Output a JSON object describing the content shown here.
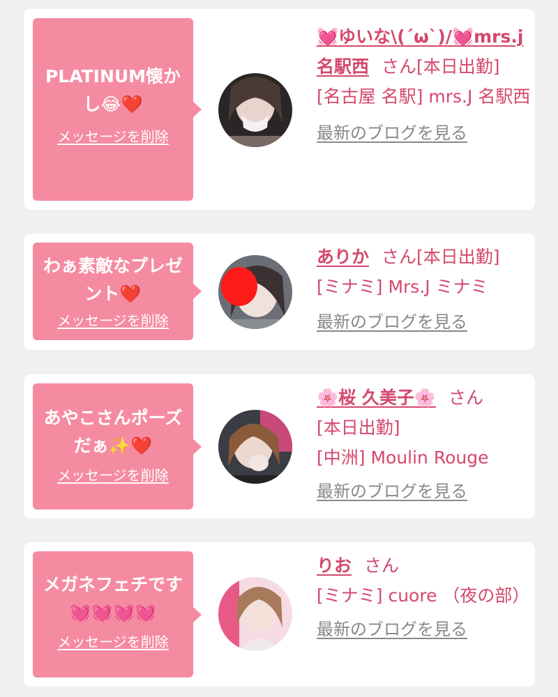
{
  "messages": [
    {
      "message": "PLATINUM懐かし😂❤️",
      "delete_label": "メッセージを削除",
      "name": "💓ゆいな\\(´ω`)/💓mrs.j名駅西",
      "honorific": "さん",
      "status": "[本日出勤]",
      "shop": "[名古屋 名駅] mrs.J 名駅西",
      "blog_link": "最新のブログを見る"
    },
    {
      "message": "わぁ素敵なプレゼント❤️",
      "delete_label": "メッセージを削除",
      "name": "ありか",
      "honorific": "さん",
      "status": "[本日出勤]",
      "shop": "[ミナミ] Mrs.J ミナミ",
      "blog_link": "最新のブログを見る"
    },
    {
      "message": "あやこさんポーズだぁ✨❤️",
      "delete_label": "メッセージを削除",
      "name": "🌸桜 久美子🌸",
      "honorific": "さん",
      "status": "[本日出勤]",
      "shop": "[中洲] Moulin Rouge",
      "blog_link": "最新のブログを見る"
    },
    {
      "message": "メガネフェチです💓💓💓💓",
      "delete_label": "メッセージを削除",
      "name": "りお",
      "honorific": "さん",
      "status": "",
      "shop": "[ミナミ] cuore （夜の部）",
      "blog_link": "最新のブログを見る"
    }
  ],
  "colors": {
    "bubble": "#f58ba1",
    "accent_text": "#d4476c",
    "link_gray": "#888888",
    "background": "#f0eff2"
  }
}
